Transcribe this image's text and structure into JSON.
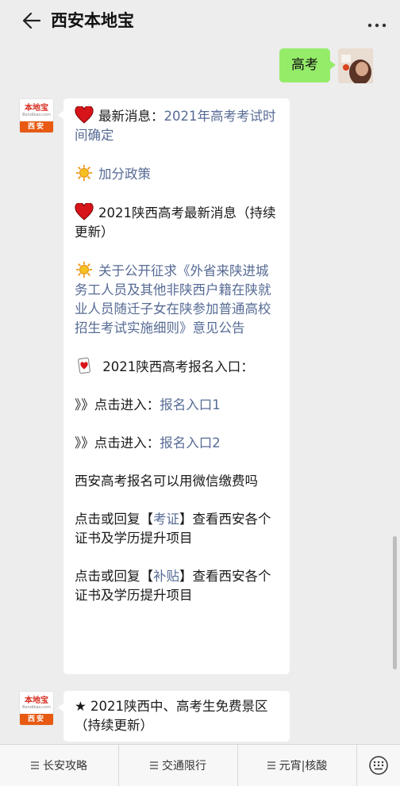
{
  "header": {
    "title": "西安本地宝"
  },
  "outgoing": {
    "text": "高考"
  },
  "bot": {
    "brand": "本地宝",
    "brand_url": "Bendibao.com",
    "city": "西安"
  },
  "message1": {
    "line1_label": "最新消息：",
    "line1_link": "2021年高考考试时间确定",
    "line2_link": "加分政策",
    "line3_text": "2021陕西高考最新消息（持续更新）",
    "line4_link": "关于公开征求《外省来陕进城务工人员及其他非陕西户籍在陕就业人员随迁子女在陕参加普通高校招生考试实施细则》意见公告",
    "line5_text": " 2021陕西高考报名入口：",
    "line6_prefix": "》》点击进入：",
    "line6_link": "报名入口1",
    "line7_prefix": "》》点击进入：",
    "line7_link": "报名入口2",
    "line8_text": "西安高考报名可以用微信缴费吗",
    "line9_pre": "点击或回复【",
    "line9_link": "考证",
    "line9_post": "】查看西安各个证书及学历提升项目",
    "line10_pre": "点击或回复【",
    "line10_link": "补贴",
    "line10_post": "】查看西安各个证书及学历提升项目"
  },
  "message2": {
    "text": "★ 2021陕西中、高考生免费景区（持续更新）"
  },
  "menu": {
    "item1": "长安攻略",
    "item2": "交通限行",
    "item3": "元宵|核酸"
  },
  "colors": {
    "link": "#576b95",
    "bubble_out": "#95ec69",
    "brand_orange": "#e85a12"
  }
}
